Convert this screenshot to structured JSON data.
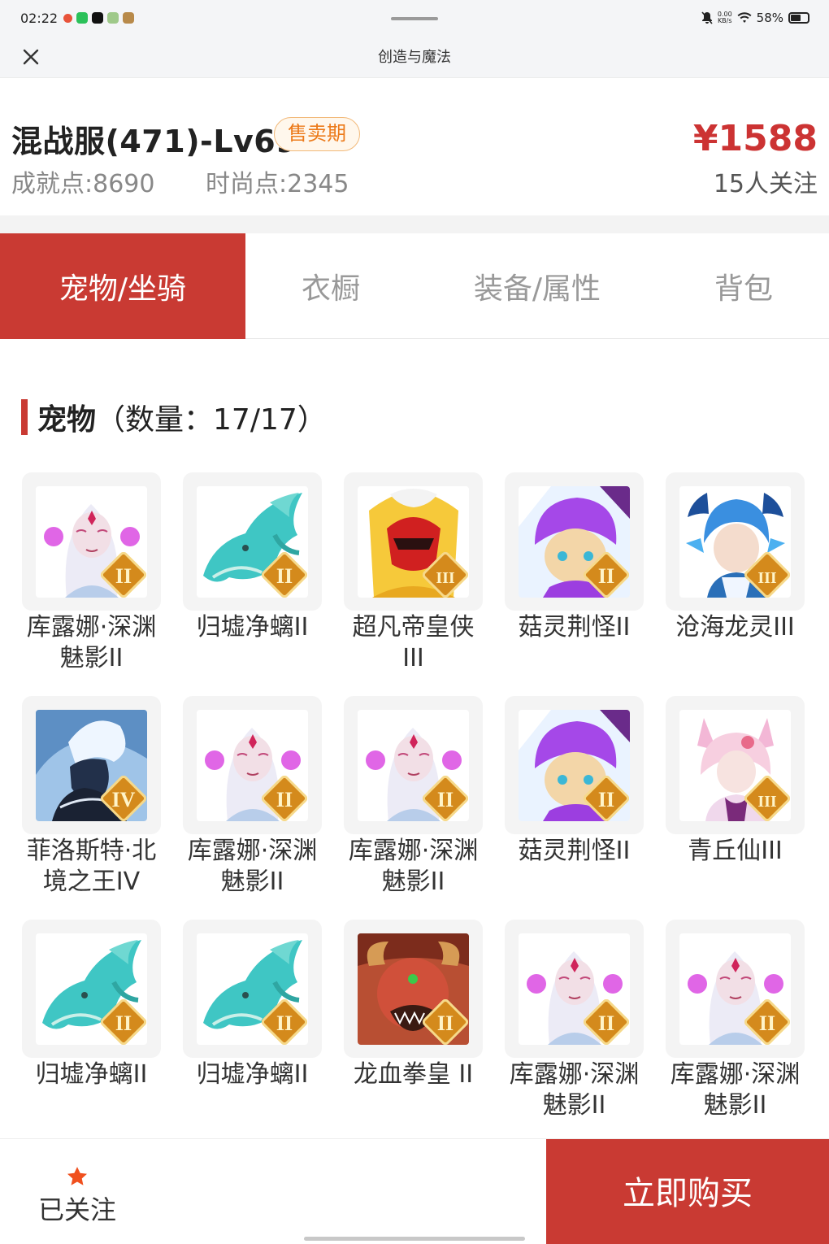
{
  "status_bar": {
    "time": "02:22",
    "net_speed_value": "0.00",
    "net_speed_unit": "KB/s",
    "battery": "58%"
  },
  "nav": {
    "title": "创造与魔法",
    "close_icon": "close-icon"
  },
  "header": {
    "server_name": "混战服(471)-Lv69",
    "status_badge": "售卖期",
    "achievement_label": "成就点:",
    "achievement_value": "8690",
    "fashion_label": "时尚点:",
    "fashion_value": "2345",
    "price": "¥1588",
    "followers": "15人关注",
    "accent_color": "#c93a33"
  },
  "tabs": [
    {
      "label": "宠物/坐骑",
      "active": true
    },
    {
      "label": "衣橱",
      "active": false
    },
    {
      "label": "装备/属性",
      "active": false
    },
    {
      "label": "背包",
      "active": false
    }
  ],
  "section": {
    "name": "宠物",
    "count": "（数量：17/17）"
  },
  "pets": [
    {
      "name": "库露娜·深渊魅影II",
      "portrait": "kuluna",
      "rank": "II"
    },
    {
      "name": "归墟净螭II",
      "portrait": "dragon-teal",
      "rank": "II"
    },
    {
      "name": "超凡帝皇侠III",
      "portrait": "emperor",
      "rank": "III"
    },
    {
      "name": "菇灵荆怪II",
      "portrait": "mushroom",
      "rank": "II"
    },
    {
      "name": "沧海龙灵III",
      "portrait": "sea-dragon",
      "rank": "III"
    },
    {
      "name": "菲洛斯特·北境之王IV",
      "portrait": "frost-king",
      "rank": "IV"
    },
    {
      "name": "库露娜·深渊魅影II",
      "portrait": "kuluna",
      "rank": "II"
    },
    {
      "name": "库露娜·深渊魅影II",
      "portrait": "kuluna",
      "rank": "II"
    },
    {
      "name": "菇灵荆怪II",
      "portrait": "mushroom",
      "rank": "II"
    },
    {
      "name": "青丘仙III",
      "portrait": "fox-fairy",
      "rank": "III"
    },
    {
      "name": "归墟净螭II",
      "portrait": "dragon-teal",
      "rank": "II"
    },
    {
      "name": "归墟净螭II",
      "portrait": "dragon-teal",
      "rank": "II"
    },
    {
      "name": "龙血拳皇 II",
      "portrait": "dragon-blood",
      "rank": "II"
    },
    {
      "name": "库露娜·深渊魅影II",
      "portrait": "kuluna",
      "rank": "II"
    },
    {
      "name": "库露娜·深渊魅影II",
      "portrait": "kuluna",
      "rank": "II"
    }
  ],
  "bottom": {
    "follow_label": "已关注",
    "follow_icon": "star-icon",
    "buy_label": "立即购买"
  }
}
